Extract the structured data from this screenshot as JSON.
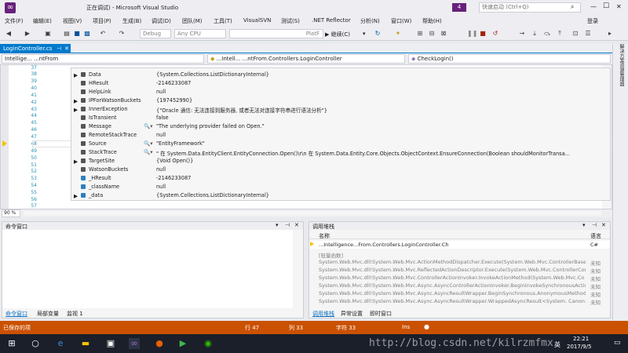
{
  "window": {
    "title_suffix": "正在调试) - Microsoft Visual Studio",
    "notification_count": "4",
    "quick_launch_placeholder": "快速启动 (Ctrl+Q)",
    "signin": "登录",
    "min": "—",
    "max": "☐",
    "close": "✕"
  },
  "menu": [
    "文件(F)",
    "编辑(E)",
    "视图(V)",
    "项目(P)",
    "生成(B)",
    "调试(D)",
    "团队(M)",
    "工具(T)",
    "VisualSVN",
    "测试(S)",
    ".NET Reflector",
    "分析(N)",
    "窗口(W)",
    "帮助(H)"
  ],
  "toolbar": {
    "config": "Debug",
    "platform": "Any CPU",
    "platform_suffix": "PlatF",
    "continue_label": "▶ 继续(C)",
    "continue_dropdown": "▾"
  },
  "tab": {
    "label": "LoginController.cs",
    "pin": "⊣",
    "close": "✕"
  },
  "navbar": {
    "project": "Intellige...  ...ntFrom",
    "class": "...Intell...  ...ntFrom.Controllers.LoginController",
    "member": "CheckLogin()"
  },
  "editor": {
    "line_numbers": [
      "37",
      "38",
      "39",
      "40",
      "41",
      "42",
      "43",
      "44",
      "45",
      "46",
      "47",
      "48",
      "49",
      "50",
      "51",
      "52",
      "53",
      "54",
      "55",
      "56",
      "57"
    ]
  },
  "datatip": {
    "rows": [
      {
        "name": "Data",
        "value": "{System.Collections.ListDictionaryInternal}",
        "expandable": true,
        "mag": false,
        "icon": "property"
      },
      {
        "name": "HResult",
        "value": "-2146233087",
        "expandable": false,
        "mag": false,
        "icon": "property"
      },
      {
        "name": "HelpLink",
        "value": "null",
        "expandable": false,
        "mag": false,
        "icon": "property"
      },
      {
        "name": "IPForWatsonBuckets",
        "value": "{197452990}",
        "expandable": true,
        "mag": false,
        "icon": "property"
      },
      {
        "name": "InnerException",
        "value": "{\"Oracle 通信: 无法连接到服务器, 或者无法对连接字符串进行语法分析\"}",
        "expandable": true,
        "mag": false,
        "icon": "property"
      },
      {
        "name": "IsTransient",
        "value": "false",
        "expandable": false,
        "mag": false,
        "icon": "property"
      },
      {
        "name": "Message",
        "value": "\"The underlying provider failed on Open.\"",
        "expandable": false,
        "mag": true,
        "icon": "property"
      },
      {
        "name": "RemoteStackTrace",
        "value": "null",
        "expandable": false,
        "mag": false,
        "icon": "property"
      },
      {
        "name": "Source",
        "value": "\"EntityFramework\"",
        "expandable": false,
        "mag": true,
        "icon": "property"
      },
      {
        "name": "StackTrace",
        "value": "\"   在 System.Data.EntityClient.EntityConnection.Open()\\r\\n   在 System.Data.Entity.Core.Objects.ObjectContext.EnsureConnection(Boolean shouldMonitorTransa...",
        "expandable": false,
        "mag": true,
        "icon": "property"
      },
      {
        "name": "TargetSite",
        "value": "{Void Open()}",
        "expandable": true,
        "mag": false,
        "icon": "property"
      },
      {
        "name": "WatsonBuckets",
        "value": "null",
        "expandable": false,
        "mag": false,
        "icon": "property"
      },
      {
        "name": "_HResult",
        "value": "-2146233087",
        "expandable": false,
        "mag": false,
        "icon": "field"
      },
      {
        "name": "_className",
        "value": "null",
        "expandable": false,
        "mag": false,
        "icon": "field"
      },
      {
        "name": "_data",
        "value": "{System.Collections.ListDictionaryInternal}",
        "expandable": true,
        "mag": false,
        "icon": "field"
      }
    ]
  },
  "zoom": "90 %",
  "cmd_pane": {
    "title": "命令窗口",
    "tabs": [
      "命令窗口",
      "局部变量",
      "监视 1"
    ]
  },
  "callstack": {
    "title": "调用堆栈",
    "col_name": "名称",
    "col_lang": "语言",
    "top_row": "...Intelligence...From.Controllers.LoginController.Ch",
    "top_lang": "C#",
    "rows": [
      {
        "name": "[轻量函数]",
        "lang": ""
      },
      {
        "name": "System.Web.Mvc.dll!System.Web.Mvc.ActionMethodDispatcher.Execute(System.Web.Mvc.ControllerBase c",
        "lang": "未知"
      },
      {
        "name": "System.Web.Mvc.dll!System.Web.Mvc.ReflectedActionDescriptor.Execute(System.Web.Mvc.ControllerCont",
        "lang": "未知"
      },
      {
        "name": "System.Web.Mvc.dll!System.Web.Mvc.ControllerActionInvoker.InvokeActionMethod(System.Web.Mvc.Co",
        "lang": "未知"
      },
      {
        "name": "System.Web.Mvc.dll!System.Web.Mvc.Async.AsyncControllerActionInvoker.BeginInvokeSynchronousActic",
        "lang": "未知"
      },
      {
        "name": "System.Web.Mvc.dll!System.Web.Mvc.Async.AsyncResultWrapper.BeginSynchronous.AnonymousMethod",
        "lang": "未知"
      },
      {
        "name": "System.Web.Mvc.dll!System.Web.Mvc.Async.AsyncResultWrapper.WrappedAsyncResult<System.  Canon:",
        "lang": "未知"
      }
    ],
    "tabs": [
      "调用堆栈",
      "异常设置",
      "即时窗口"
    ]
  },
  "status": {
    "left": "已保存的项",
    "line": "行 47",
    "col": "列 33",
    "ch": "字符 33",
    "mode": "Ins"
  },
  "right_dock_label": "解决方案资源管理器",
  "taskbar": {
    "time": "22:21",
    "date": "2017/9/5",
    "lang": "英",
    "watermark": "http://blog.csdn.net/kilrzmfmx"
  },
  "colors": {
    "accent": "#007acc",
    "status": "#ca5100",
    "keyword": "#2b91af"
  }
}
